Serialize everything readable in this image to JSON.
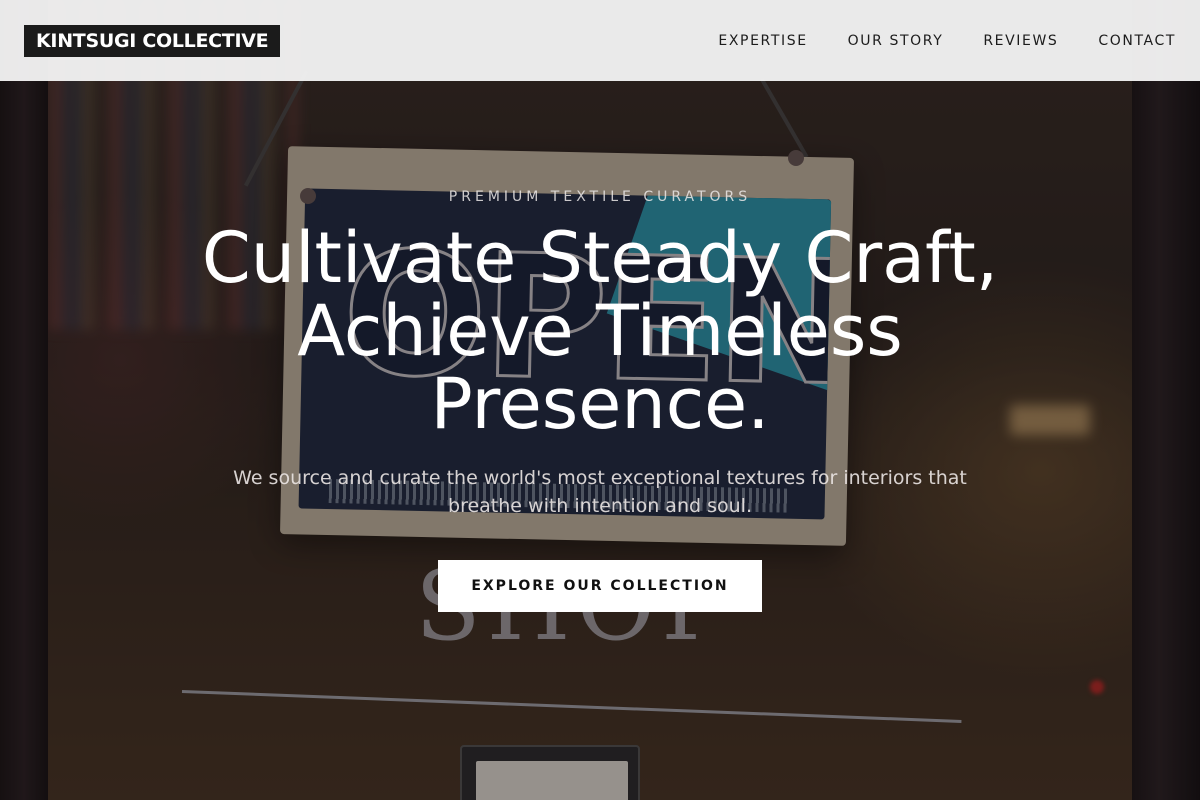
{
  "brand": {
    "name": "KINTSUGI COLLECTIVE"
  },
  "nav": {
    "items": [
      {
        "label": "EXPERTISE"
      },
      {
        "label": "OUR STORY"
      },
      {
        "label": "REVIEWS"
      },
      {
        "label": "CONTACT"
      }
    ]
  },
  "hero": {
    "eyebrow": "PREMIUM TEXTILE CURATORS",
    "headline": "Cultivate Steady Craft, Achieve Timeless Presence.",
    "subtext": "We source and curate the world's most exceptional textures for interiors that breathe with intention and soul.",
    "cta_label": "EXPLORE OUR COLLECTION"
  },
  "background_photo": {
    "sign_word": "OPEN",
    "painted_word": "SHOP"
  },
  "colors": {
    "header_bg": "#f2f2f2",
    "logo_bg": "#1b1b1b",
    "cta_bg": "#ffffff",
    "sign_teal": "#2b9cb4",
    "sign_navy": "#1f2a44"
  }
}
